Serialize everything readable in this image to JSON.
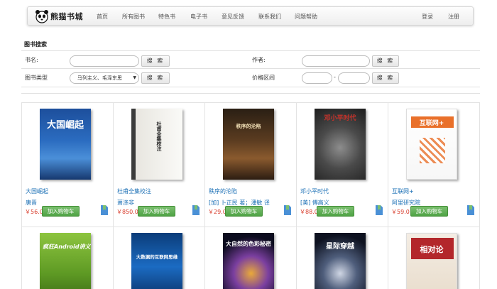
{
  "brand": {
    "name": "熊猫书城",
    "logo": "panda-logo"
  },
  "nav": {
    "items": [
      "首页",
      "所有图书",
      "特色书",
      "电子书",
      "意见反馈",
      "联系我们",
      "问题帮助"
    ],
    "login": "登录",
    "register": "注册"
  },
  "search": {
    "title": "图书搜索",
    "name_label": "书名:",
    "author_label": "作者:",
    "type_label": "图书类型",
    "price_label": "价格区间",
    "type_selected": "马列主义、毛泽东思",
    "search_button": "搜  索",
    "price_separator": "-"
  },
  "colors": {
    "link": "#1a6fb5",
    "price": "#d83b2a",
    "cart_button": "#5aad4e"
  },
  "books": [
    {
      "title": "大国崛起",
      "author": "唐晋",
      "price": "￥56.0",
      "cover_text": "大国崛起"
    },
    {
      "title": "杜甫全集校注",
      "author": "萧涤非",
      "price": "￥850.0",
      "cover_text": "杜甫全集校注"
    },
    {
      "title": "秩序的沦陷",
      "author": "[加] 卜正民 著；潘敏 译",
      "price": "￥29.0",
      "cover_text": "秩序的沦陷"
    },
    {
      "title": "邓小平时代",
      "author": "[美] 傅高义",
      "price": "￥88.0",
      "cover_text": "邓小平时代"
    },
    {
      "title": "互联网+",
      "author": "阿里研究院",
      "price": "￥59.0",
      "cover_text": "互联网+"
    },
    {
      "title": "",
      "author": "",
      "price": "",
      "cover_text": "疯狂Android讲义"
    },
    {
      "title": "",
      "author": "",
      "price": "",
      "cover_text": "大数据的互联网思维"
    },
    {
      "title": "",
      "author": "",
      "price": "",
      "cover_text": "大自然的色彩秘密"
    },
    {
      "title": "",
      "author": "",
      "price": "",
      "cover_text": "星际穿越"
    },
    {
      "title": "",
      "author": "",
      "price": "",
      "cover_text": "相对论"
    }
  ],
  "cart_button_label": "加入购物车",
  "favorite_icon": "bookmark-icon"
}
